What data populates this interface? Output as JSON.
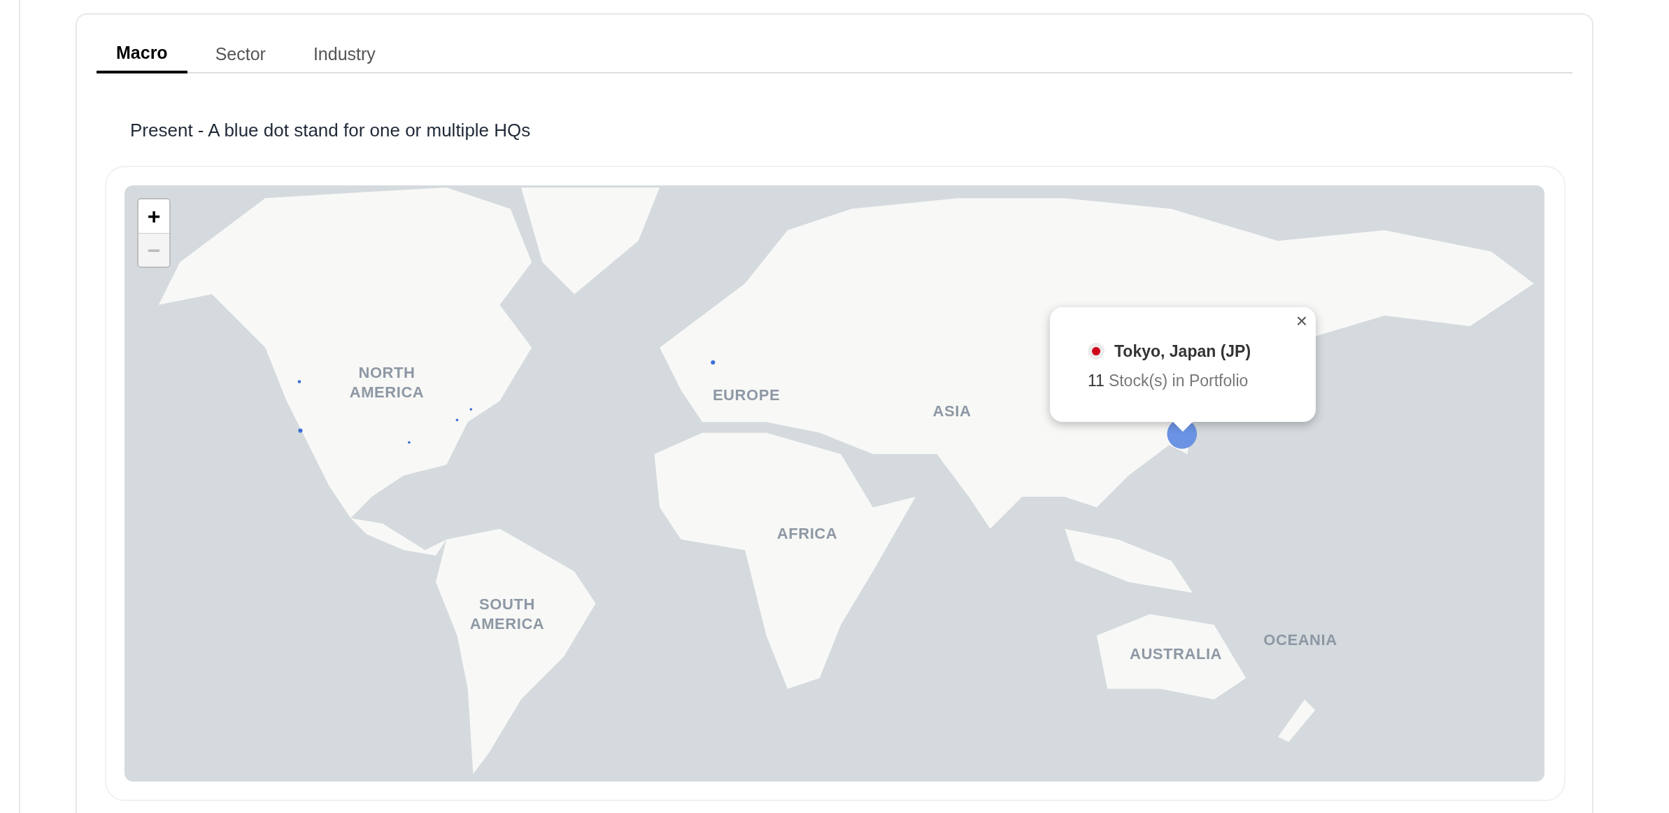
{
  "tabs": [
    {
      "label": "Macro",
      "selected": true
    },
    {
      "label": "Sector",
      "selected": false
    },
    {
      "label": "Industry",
      "selected": false
    }
  ],
  "caption": "Present - A blue dot stand for one or multiple HQs",
  "map": {
    "zoom_controls": [
      {
        "label": "+",
        "disabled": false
      },
      {
        "label": "−",
        "disabled": true
      }
    ],
    "labels": [
      "NORTH\nAMERICA",
      "EUROPE",
      "ASIA",
      "AFRICA",
      "SOUTH\nAMERICA",
      "AUSTRALIA",
      "OCEANIA"
    ],
    "popup": {
      "close": "×",
      "title": "Tokyo, Japan (JP)",
      "count": "11",
      "description": "Stock(s) in Portfolio"
    }
  }
}
